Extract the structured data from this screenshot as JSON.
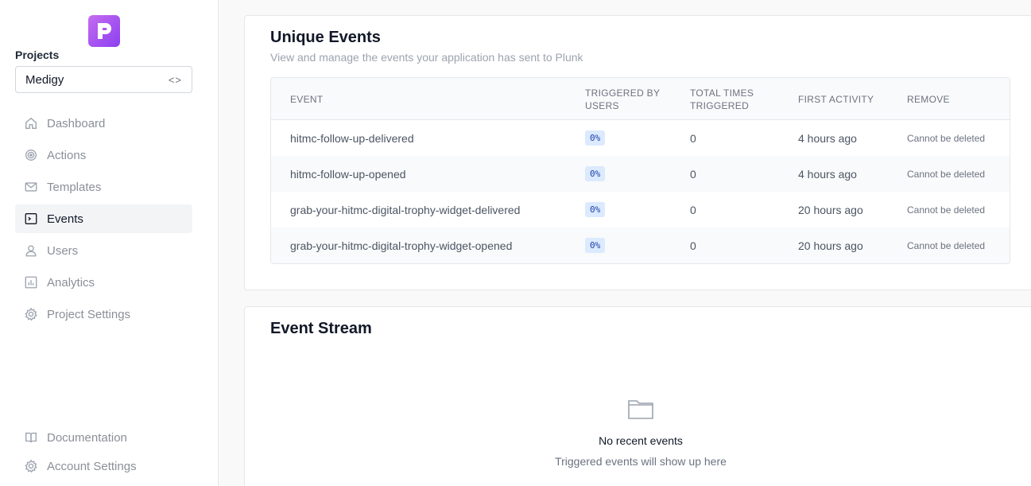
{
  "sidebar": {
    "projects_label": "Projects",
    "project_select": {
      "value": "Medigy",
      "chevron": "<>"
    },
    "nav": [
      {
        "label": "Dashboard",
        "icon": "home-icon",
        "active": false
      },
      {
        "label": "Actions",
        "icon": "target-icon",
        "active": false
      },
      {
        "label": "Templates",
        "icon": "mail-icon",
        "active": false
      },
      {
        "label": "Events",
        "icon": "terminal-icon",
        "active": true
      },
      {
        "label": "Users",
        "icon": "user-icon",
        "active": false
      },
      {
        "label": "Analytics",
        "icon": "chart-icon",
        "active": false
      },
      {
        "label": "Project Settings",
        "icon": "gear-icon",
        "active": false
      }
    ],
    "bottom_nav": [
      {
        "label": "Documentation",
        "icon": "book-icon"
      },
      {
        "label": "Account Settings",
        "icon": "gear-icon"
      }
    ]
  },
  "unique_events": {
    "title": "Unique Events",
    "subtitle": "View and manage the events your application has sent to Plunk",
    "columns": [
      "Event",
      "Triggered by users",
      "Total times triggered",
      "First activity",
      "Remove"
    ],
    "rows": [
      {
        "event": "hitmc-follow-up-delivered",
        "triggered_by_users": "0%",
        "total": "0",
        "first_activity": "4 hours ago",
        "remove": "Cannot be deleted"
      },
      {
        "event": "hitmc-follow-up-opened",
        "triggered_by_users": "0%",
        "total": "0",
        "first_activity": "4 hours ago",
        "remove": "Cannot be deleted"
      },
      {
        "event": "grab-your-hitmc-digital-trophy-widget-delivered",
        "triggered_by_users": "0%",
        "total": "0",
        "first_activity": "20 hours ago",
        "remove": "Cannot be deleted"
      },
      {
        "event": "grab-your-hitmc-digital-trophy-widget-opened",
        "triggered_by_users": "0%",
        "total": "0",
        "first_activity": "20 hours ago",
        "remove": "Cannot be deleted"
      }
    ]
  },
  "event_stream": {
    "title": "Event Stream",
    "empty_title": "No recent events",
    "empty_subtitle": "Triggered events will show up here"
  },
  "colors": {
    "brand": "#a855f7",
    "badge_bg": "#dbeafe",
    "badge_text": "#1e40af"
  }
}
